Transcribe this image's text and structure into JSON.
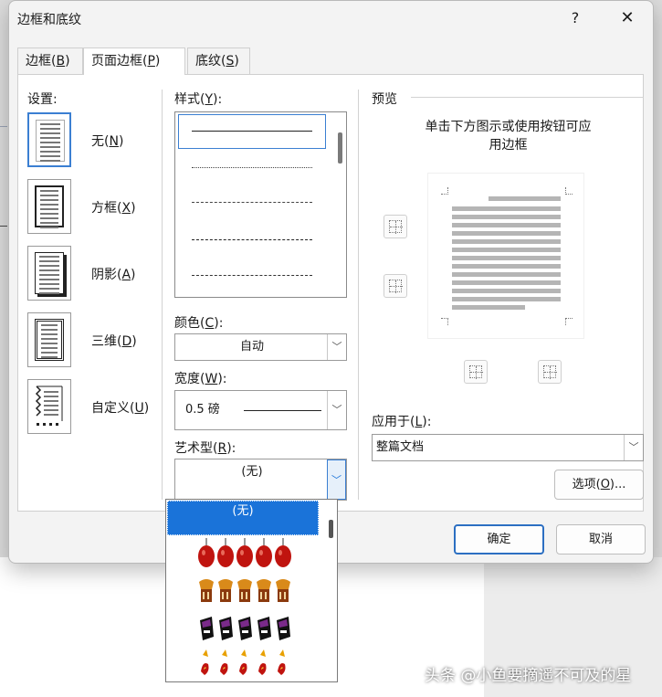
{
  "dialog": {
    "title": "边框和底纹",
    "help": "?",
    "close": "✕"
  },
  "tabs": [
    {
      "text": "边框(",
      "key": "B",
      "end": ")"
    },
    {
      "text": "页面边框(",
      "key": "P",
      "end": ")"
    },
    {
      "text": "底纹(",
      "key": "S",
      "end": ")"
    }
  ],
  "settings": {
    "label": "设置:",
    "items": [
      {
        "text": "无(",
        "key": "N",
        "end": ")"
      },
      {
        "text": "方框(",
        "key": "X",
        "end": ")"
      },
      {
        "text": "阴影(",
        "key": "A",
        "end": ")"
      },
      {
        "text": "三维(",
        "key": "D",
        "end": ")"
      },
      {
        "text": "自定义(",
        "key": "U",
        "end": ")"
      }
    ]
  },
  "style": {
    "label": "样式(",
    "key": "Y",
    "end": "):"
  },
  "color": {
    "label": "颜色(",
    "key": "C",
    "end": "):",
    "value": "自动"
  },
  "width": {
    "label": "宽度(",
    "key": "W",
    "end": "):",
    "value": "0.5 磅"
  },
  "art": {
    "label": "艺术型(",
    "key": "R",
    "end": "):",
    "value": "(无)",
    "list_selected": "(无)"
  },
  "preview": {
    "label": "预览",
    "hint_line1": "单击下方图示或使用按钮可应",
    "hint_line2": "用边框"
  },
  "apply_to": {
    "label": "应用于(",
    "key": "L",
    "end": "):",
    "value": "整篇文档"
  },
  "options_button": {
    "text": "选项(",
    "key": "O",
    "end": ")..."
  },
  "ok_button": "确定",
  "cancel_button": "取消",
  "watermark": "头条 @小鱼要摘遥不可及的星",
  "colors": {
    "accent": "#1a73d9",
    "art_red": "#c0140f",
    "art_brown": "#8b3a0e",
    "art_purple": "#7a2a8a"
  }
}
